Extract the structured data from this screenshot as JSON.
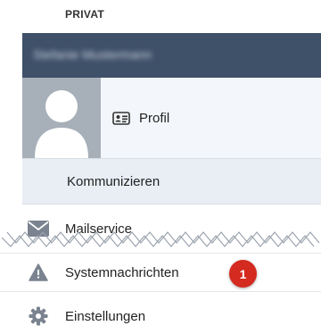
{
  "section": {
    "title": "PRIVAT"
  },
  "user": {
    "name": "Stefanie Mustermann",
    "name_blurred": true
  },
  "profile": {
    "label": "Profil",
    "icon": "id-card-icon"
  },
  "communicate": {
    "label": "Kommunizieren"
  },
  "menu": {
    "mail": {
      "label": "Mailservice",
      "icon": "envelope-icon"
    },
    "system": {
      "label": "Systemnachrichten",
      "icon": "warning-icon",
      "badge": "1"
    },
    "settings": {
      "label": "Einstellungen",
      "icon": "gear-icon"
    }
  },
  "colors": {
    "banner": "#3f5069",
    "highlight_bg": "#e9eef5",
    "avatar_bg": "#a7afb9",
    "badge": "#d42a1f",
    "icon": "#7a838f"
  }
}
